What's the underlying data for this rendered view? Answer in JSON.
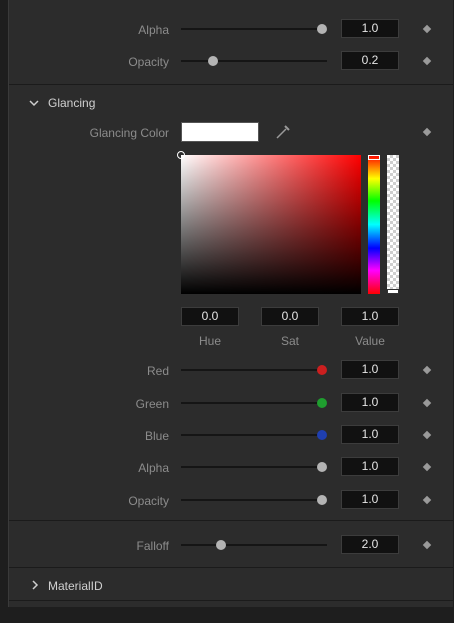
{
  "top_params": [
    {
      "label": "Alpha",
      "value": "1.0",
      "slider_fraction": 1.0
    },
    {
      "label": "Opacity",
      "value": "0.2",
      "slider_fraction": 0.2
    }
  ],
  "glancing": {
    "section_title": "Glancing",
    "color_label": "Glancing Color",
    "swatch_color": "#ffffff",
    "hue_value": "0.0",
    "sat_value": "0.0",
    "val_value": "1.0",
    "hue_label": "Hue",
    "sat_label": "Sat",
    "val_label": "Value",
    "channels": [
      {
        "label": "Red",
        "value": "1.0",
        "knob_color": "#cc1f1f",
        "slider_fraction": 1.0
      },
      {
        "label": "Green",
        "value": "1.0",
        "knob_color": "#1f9e2f",
        "slider_fraction": 1.0
      },
      {
        "label": "Blue",
        "value": "1.0",
        "knob_color": "#1f3fb0",
        "slider_fraction": 1.0
      },
      {
        "label": "Alpha",
        "value": "1.0",
        "knob_color": "#b4b4b4",
        "slider_fraction": 1.0
      },
      {
        "label": "Opacity",
        "value": "1.0",
        "knob_color": "#b4b4b4",
        "slider_fraction": 1.0
      }
    ]
  },
  "falloff": {
    "label": "Falloff",
    "value": "2.0",
    "slider_fraction": 0.27
  },
  "material": {
    "section_title": "MaterialID"
  },
  "icons": [
    "chevron-down-icon",
    "chevron-right-icon",
    "eyedropper-icon",
    "keyframe-icon"
  ]
}
